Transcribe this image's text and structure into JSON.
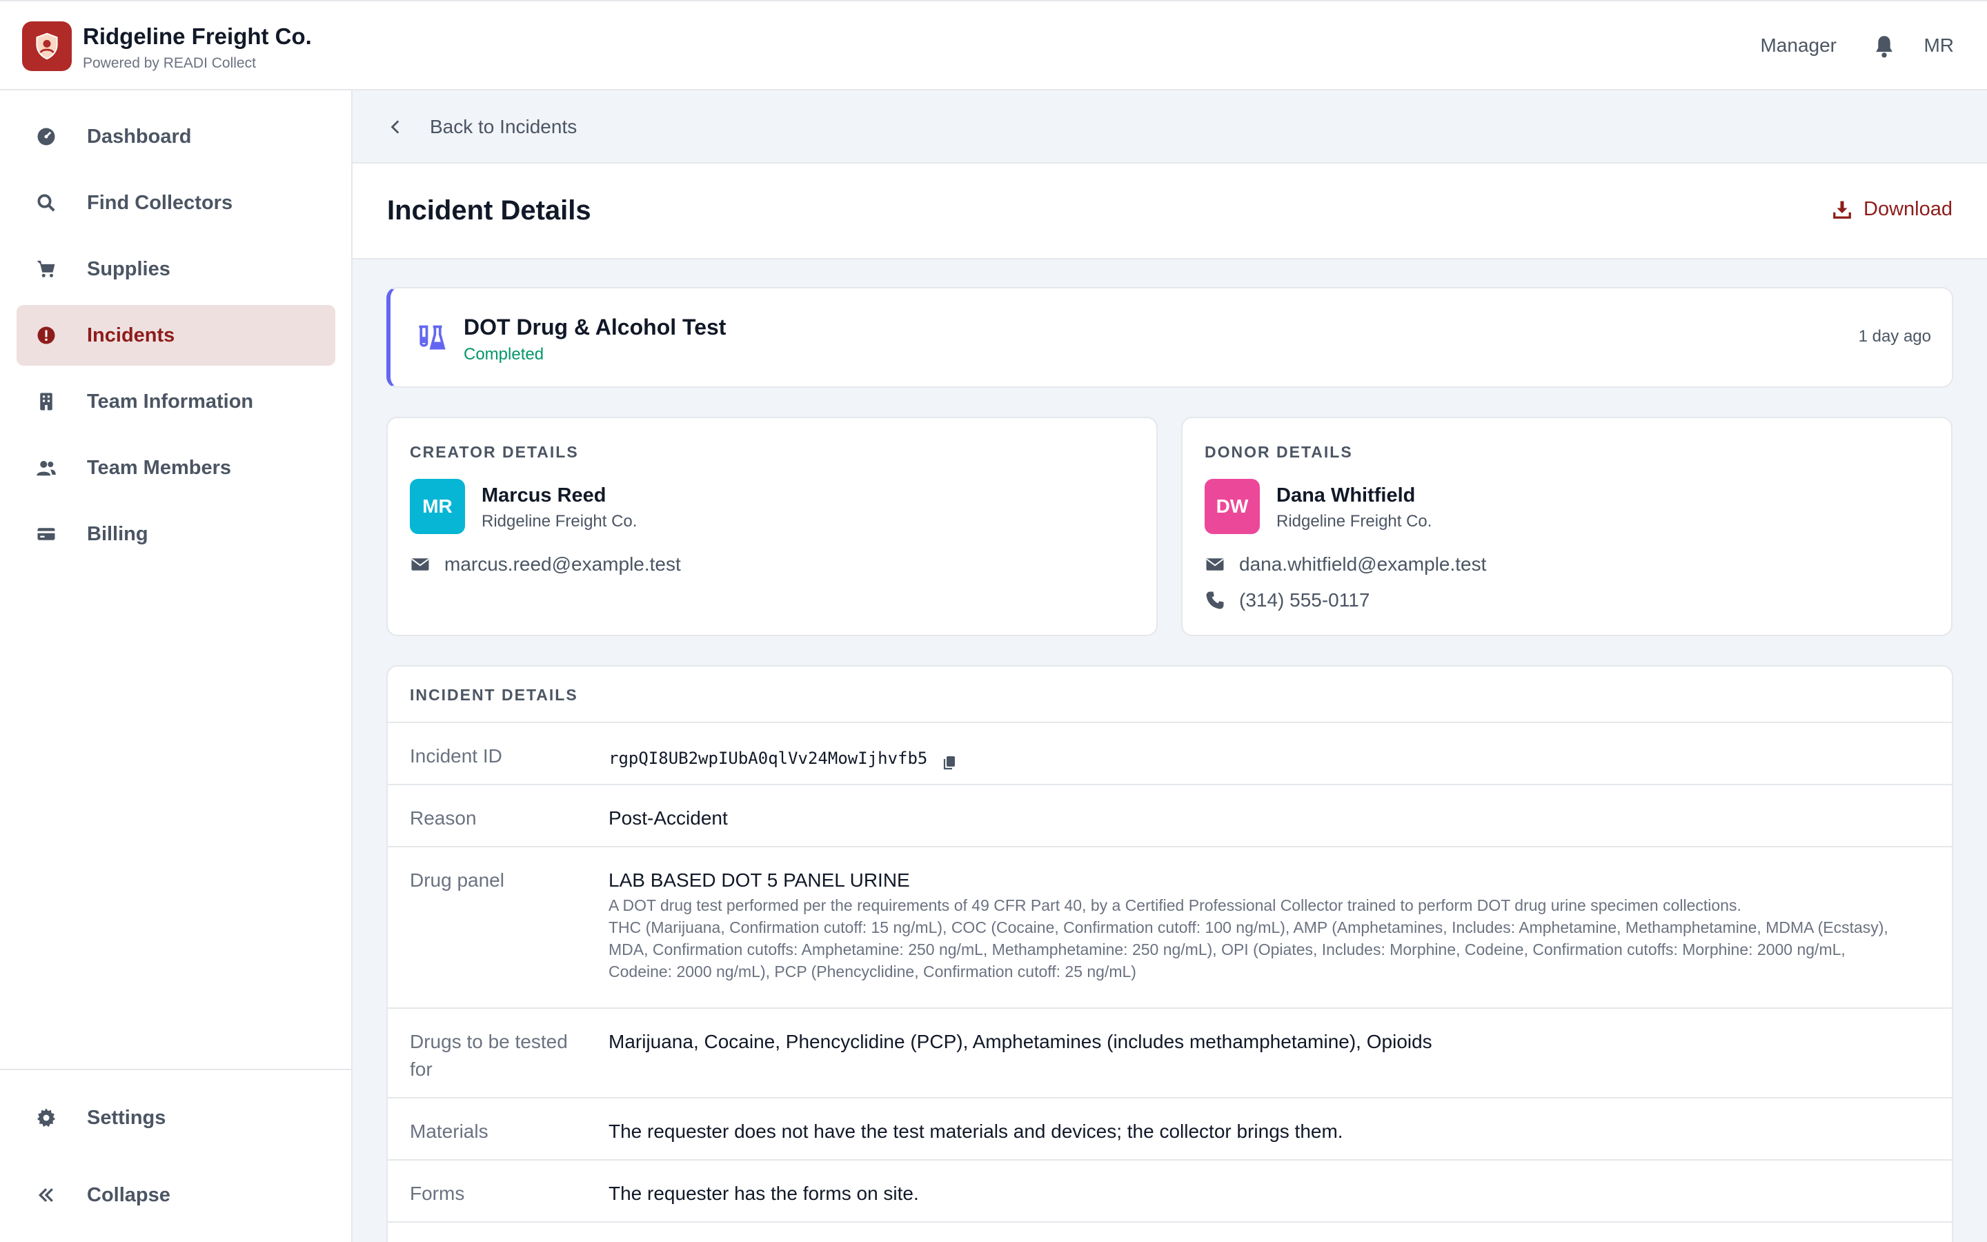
{
  "header": {
    "brand_name": "Ridgeline Freight Co.",
    "brand_sub": "Powered by READI Collect",
    "role": "Manager",
    "user_initials": "MR"
  },
  "sidebar": {
    "items": [
      {
        "label": "Dashboard",
        "icon": "dashboard-icon"
      },
      {
        "label": "Find Collectors",
        "icon": "search-icon"
      },
      {
        "label": "Supplies",
        "icon": "cart-icon"
      },
      {
        "label": "Incidents",
        "icon": "alert-icon",
        "active": true
      },
      {
        "label": "Team Information",
        "icon": "building-icon"
      },
      {
        "label": "Team Members",
        "icon": "users-icon"
      },
      {
        "label": "Billing",
        "icon": "credit-card-icon"
      }
    ],
    "settings_label": "Settings",
    "collapse_label": "Collapse"
  },
  "main": {
    "back_label": "Back to Incidents",
    "title": "Incident Details",
    "download_label": "Download",
    "test": {
      "title": "DOT Drug & Alcohol Test",
      "status": "Completed",
      "time": "1 day ago"
    },
    "creator": {
      "section_label": "CREATOR DETAILS",
      "initials": "MR",
      "name": "Marcus Reed",
      "org": "Ridgeline Freight Co.",
      "email": "marcus.reed@example.test",
      "avatar_color": "#06b6d4"
    },
    "donor": {
      "section_label": "DONOR DETAILS",
      "initials": "DW",
      "name": "Dana Whitfield",
      "org": "Ridgeline Freight Co.",
      "email": "dana.whitfield@example.test",
      "phone": "(314) 555-0117",
      "avatar_color": "#ec4899"
    },
    "details": {
      "section_label": "INCIDENT DETAILS",
      "incident_id_label": "Incident ID",
      "incident_id": "rgpQI8UB2wpIUbA0qlVv24MowIjhvfb5",
      "reason_label": "Reason",
      "reason": "Post-Accident",
      "panel_label": "Drug panel",
      "panel_name": "LAB BASED DOT 5 PANEL URINE",
      "panel_desc": "A DOT drug test performed per the requirements of 49 CFR Part 40, by a Certified Professional Collector trained to perform DOT drug urine specimen collections.",
      "panel_cutoffs": "THC (Marijuana, Confirmation cutoff: 15 ng/mL), COC (Cocaine, Confirmation cutoff: 100 ng/mL), AMP (Amphetamines, Includes: Amphetamine, Methamphetamine, MDMA (Ecstasy), MDA, Confirmation cutoffs: Amphetamine: 250 ng/mL, Methamphetamine: 250 ng/mL), OPI (Opiates, Includes: Morphine, Codeine, Confirmation cutoffs: Morphine: 2000 ng/mL, Codeine: 2000 ng/mL), PCP (Phencyclidine, Confirmation cutoff: 25 ng/mL)",
      "drugs_label": "Drugs to be tested for",
      "drugs": "Marijuana, Cocaine, Phencyclidine (PCP), Amphetamines (includes methamphetamine), Opioids",
      "materials_label": "Materials",
      "materials": "The requester does not have the test materials and devices; the collector brings them.",
      "forms_label": "Forms",
      "forms": "The requester has the forms on site."
    }
  },
  "colors": {
    "accent": "#8d1d1b",
    "brand": "#b02a27",
    "active_bg": "#efe0e0",
    "test_border": "#6366f1",
    "status_green": "#059669"
  }
}
